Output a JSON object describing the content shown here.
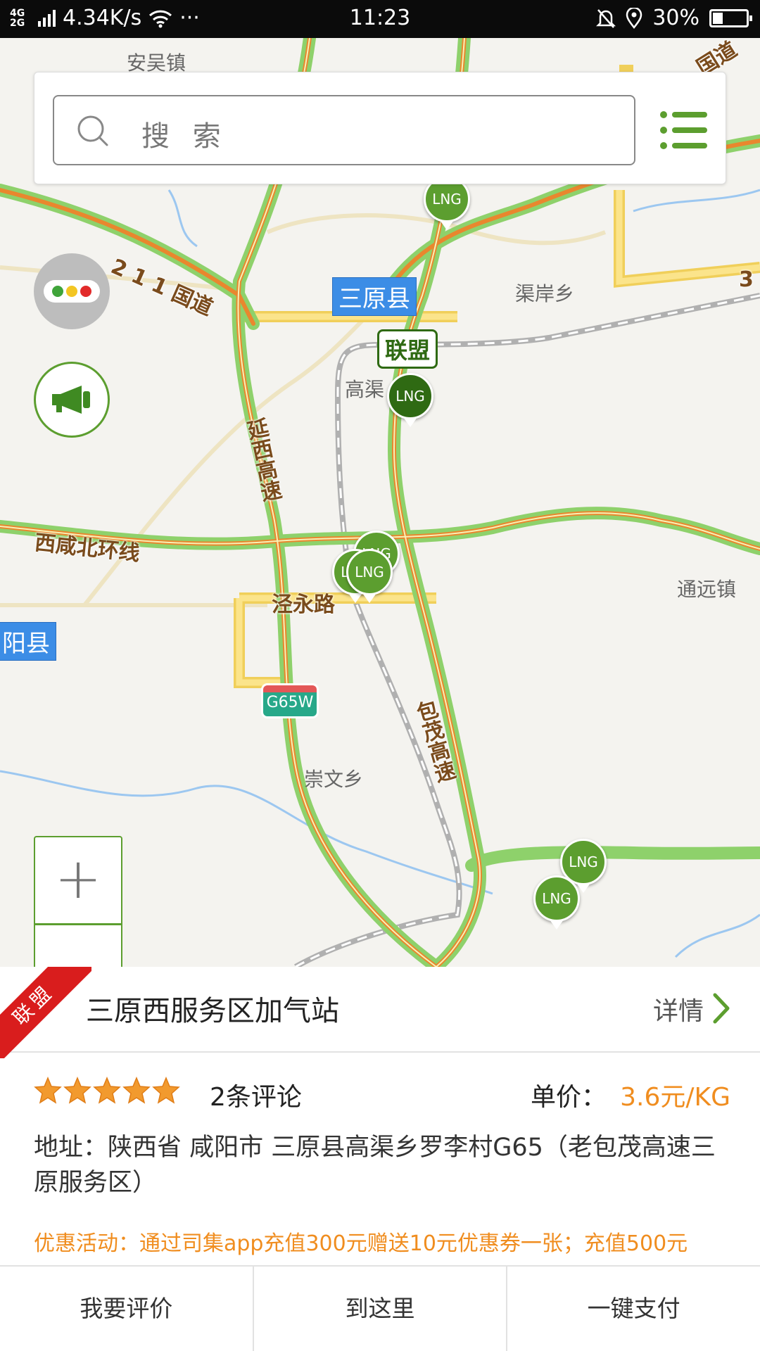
{
  "status_bar": {
    "network": "4G 2G",
    "speed": "4.34K/s",
    "more": "···",
    "time": "11:23",
    "battery": "30%"
  },
  "search": {
    "placeholder": "搜 索"
  },
  "map": {
    "place_labels": {
      "anwu": "安吴镇",
      "qu_an": "渠岸乡",
      "gaoqu": "高渠",
      "tongyuan": "通远镇",
      "chongwen": "崇文乡"
    },
    "road_labels": {
      "g211": "2 1 1 国道",
      "yanxi": "延西高速",
      "xixian": "西咸北环线",
      "jingyong": "泾永路",
      "baomao": "包茂高速",
      "edge_road": "国道",
      "edge_3": "3"
    },
    "county_labels": {
      "sanyuan": "三原县",
      "yang": "阳县"
    },
    "shield": "G65W",
    "lianmeng_tag": "联盟",
    "marker_label": "LNG"
  },
  "colors": {
    "accent_green": "#5c9e2f",
    "dark_green": "#2f6a13",
    "ribbon_red": "#d91d1d",
    "price_orange": "#f08d1f",
    "county_blue": "#3c8de6"
  },
  "icons": [
    "search-icon",
    "list-icon",
    "traffic-light-icon",
    "megaphone-icon",
    "zoom-in-icon",
    "chevron-right-icon",
    "star-icon"
  ],
  "detail": {
    "ribbon": "联盟",
    "station_name": "三原西服务区加气站",
    "detail_link": "详情",
    "rating": 5,
    "review_count": "2条评论",
    "price_label": "单价：",
    "price_value": "3.6元/KG",
    "address": "地址：陕西省 咸阳市 三原县高渠乡罗李村G65（老包茂高速三原服务区）",
    "promo": "优惠活动：通过司集app充值300元赠送10元优惠券一张；充值500元"
  },
  "actions": {
    "review": "我要评价",
    "navigate": "到这里",
    "pay": "一键支付"
  }
}
